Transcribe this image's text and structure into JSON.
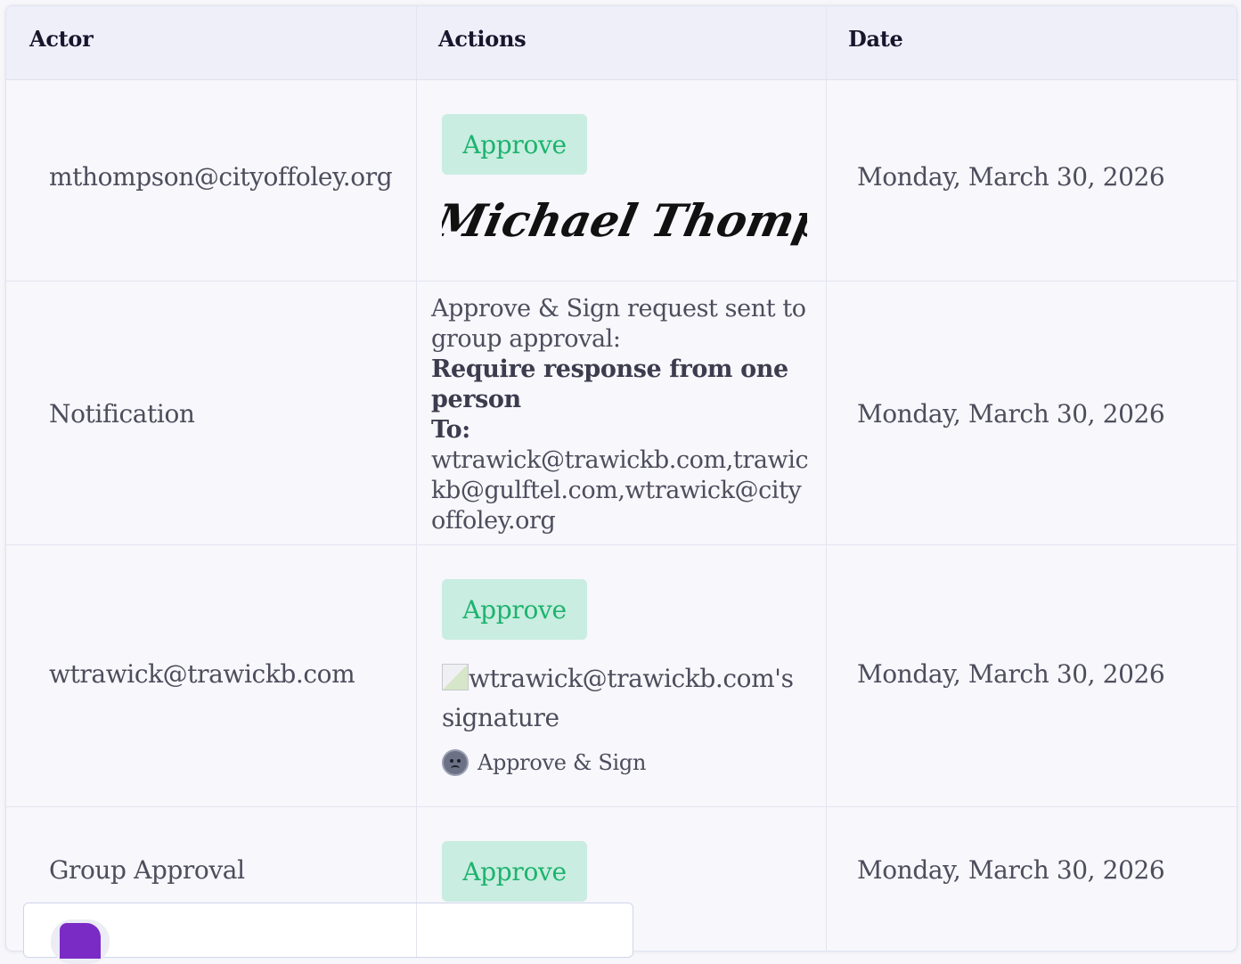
{
  "table": {
    "headers": {
      "actor": "Actor",
      "actions": "Actions",
      "date": "Date"
    },
    "rows": [
      {
        "actor": "mthompson@cityoffoley.org",
        "action_button": "Approve",
        "signature_text": "Michael Thompson",
        "date": "Monday, March 30, 2026"
      },
      {
        "actor": "Notification",
        "message_line": "Approve & Sign request sent to group approval:",
        "requirement": "Require response from one person",
        "to_label": "To:",
        "recipients": "wtrawick@trawickb.com,trawickb@gulftel.com,wtrawick@cityoffoley.org",
        "date": "Monday, March 30, 2026"
      },
      {
        "actor": "wtrawick@trawickb.com",
        "action_button": "Approve",
        "signature_alt": "wtrawick@trawickb.com's signature",
        "method_label": "Approve & Sign",
        "method_icon": "sad-face-icon",
        "date": "Monday, March 30, 2026"
      },
      {
        "actor": "Group Approval",
        "action_button": "Approve",
        "date": "Monday, March 30, 2026"
      }
    ]
  },
  "popup": {
    "icon": "document-icon",
    "icon_color": "#7a2bc6"
  },
  "colors": {
    "approve_bg": "#c9ede0",
    "approve_text": "#1db36e",
    "header_bg": "#eeeff9"
  }
}
